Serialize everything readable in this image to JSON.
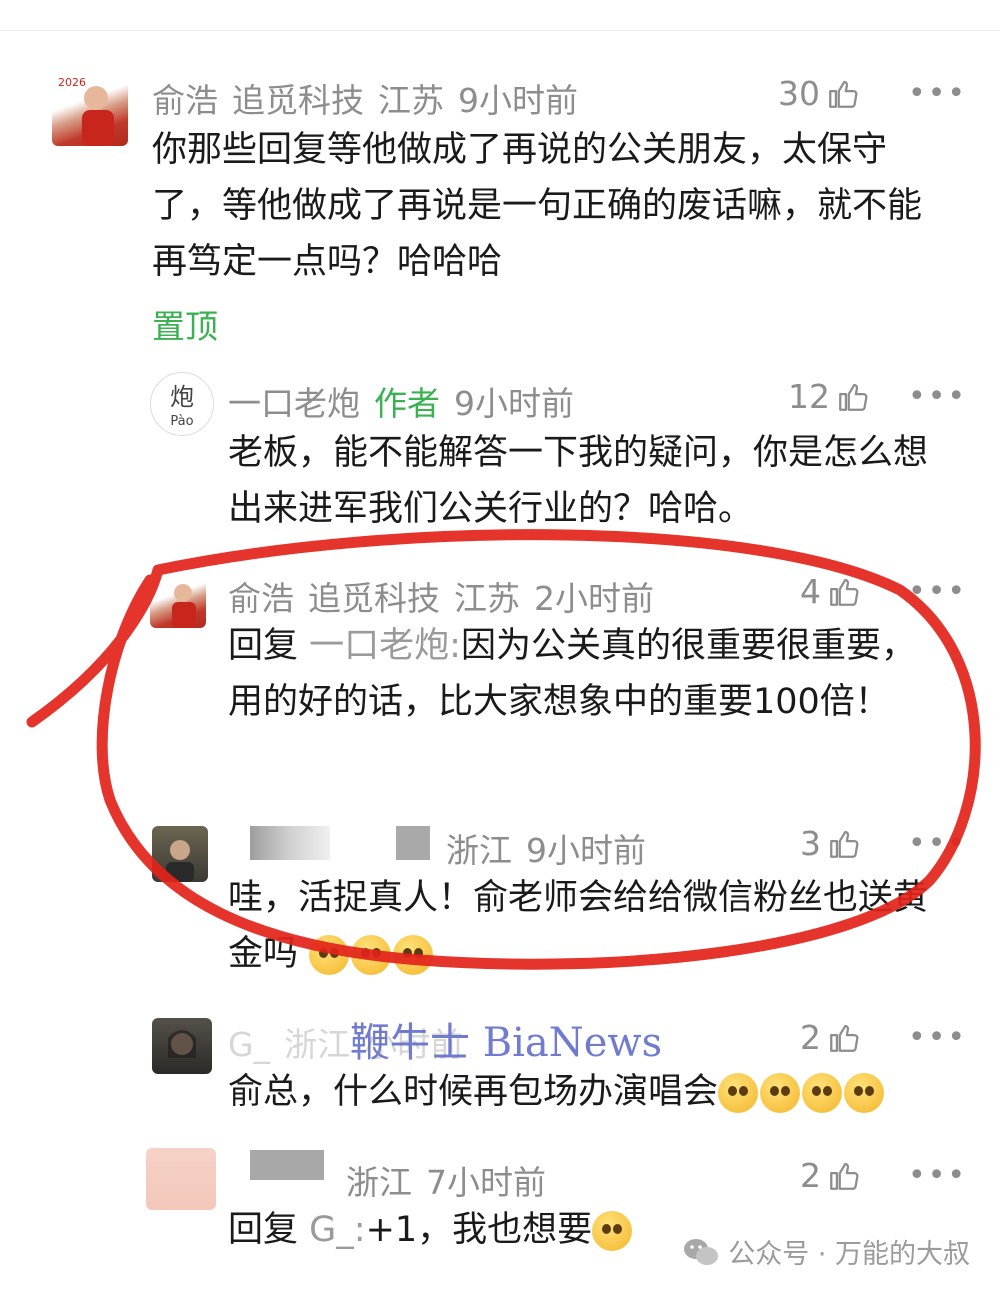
{
  "comments": [
    {
      "user": "俞浩",
      "company": "追觅科技",
      "region": "江苏",
      "time": "9小时前",
      "likes": "30",
      "text": "你那些回复等他做成了再说的公关朋友，太保守了，等他做成了再说是一句正确的废话嘛，就不能再笃定一点吗？哈哈哈",
      "pinned": "置顶"
    },
    {
      "user": "一口老炮",
      "author_tag": "作者",
      "time": "9小时前",
      "likes": "12",
      "avatar_text": "炮",
      "avatar_sub": "Pào",
      "text": "老板，能不能解答一下我的疑问，你是怎么想出来进军我们公关行业的？哈哈。"
    },
    {
      "user": "俞浩",
      "company": "追觅科技",
      "region": "江苏",
      "time": "2小时前",
      "likes": "4",
      "reply_label": "回复",
      "reply_to": "一口老炮:",
      "text": "因为公关真的很重要很重要，用的好的话，比大家想象中的重要100倍！"
    },
    {
      "region": "浙江",
      "time": "9小时前",
      "likes": "3",
      "text": "哇，活捉真人！俞老师会给给微信粉丝也送黄金吗"
    },
    {
      "user_partial": "G_",
      "region_partial": "浙江",
      "time_partial": "小时前",
      "likes": "2",
      "text": "俞总，什么时候再包场办演唱会"
    },
    {
      "region": "浙江",
      "time": "7小时前",
      "likes": "2",
      "reply_label": "回复",
      "reply_to": "G_:",
      "text": "+1，我也想要"
    }
  ],
  "more_label": "•••",
  "watermark": "鞭牛士 BiaNews",
  "footer": {
    "prefix": "公众号 · 万能的大叔"
  },
  "colors": {
    "green": "#3bb152",
    "meta_gray": "#8d8d8d",
    "annotation_red": "#e2231a",
    "watermark_blue": "#5966c9"
  },
  "icons": [
    "thumbs-up-icon",
    "more-icon",
    "wechat-icon",
    "emoji-icon"
  ]
}
